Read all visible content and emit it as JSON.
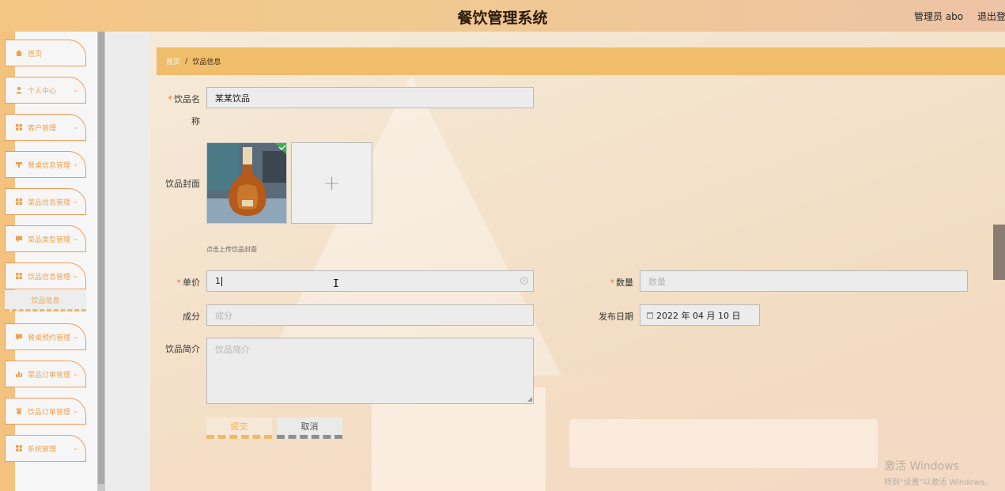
{
  "header": {
    "title": "餐饮管理系统",
    "user_label": "管理员 abo",
    "logout_label": "退出登"
  },
  "sidebar": {
    "items": [
      {
        "label": "首页",
        "icon": "home-icon",
        "has_chevron": false
      },
      {
        "label": "个人中心",
        "icon": "user-icon",
        "has_chevron": true
      },
      {
        "label": "客户管理",
        "icon": "grid-icon",
        "has_chevron": true
      },
      {
        "label": "餐桌信息管理",
        "icon": "table-icon",
        "has_chevron": true
      },
      {
        "label": "菜品信息管理",
        "icon": "grid-icon",
        "has_chevron": true
      },
      {
        "label": "菜品类型管理",
        "icon": "chat-icon",
        "has_chevron": true
      },
      {
        "label": "饮品信息管理",
        "icon": "grid-icon",
        "has_chevron": true
      },
      {
        "label": "餐桌预约管理",
        "icon": "chat-icon",
        "has_chevron": true
      },
      {
        "label": "菜品订单管理",
        "icon": "bar-chart-icon",
        "has_chevron": true
      },
      {
        "label": "饮品订单管理",
        "icon": "trash-icon",
        "has_chevron": true
      },
      {
        "label": "系统管理",
        "icon": "grid-icon",
        "has_chevron": true
      }
    ],
    "active_submenu": "饮品信息"
  },
  "breadcrumb": {
    "home": "首页",
    "separator": "/",
    "current": "饮品信息"
  },
  "form": {
    "name_label_line1": "饮品名",
    "name_label_line2": "称",
    "name_value": "某某饮品",
    "cover_label": "饮品封面",
    "cover_hint": "点击上传饮品封面",
    "add_symbol": "+",
    "price_label": "单价",
    "price_value": "1",
    "quantity_label": "数量",
    "quantity_placeholder": "数量",
    "ingredient_label": "成分",
    "ingredient_placeholder": "成分",
    "date_label": "发布日期",
    "date_value": "2022 年 04 月 10 日",
    "intro_label": "饮品简介",
    "intro_placeholder": "饮品简介",
    "required_mark": "*",
    "submit_label": "提交",
    "cancel_label": "取消"
  },
  "watermark": {
    "line1": "激活 Windows",
    "line2": "转到\"设置\"以激活 Windows。"
  },
  "colors": {
    "accent": "#f0bd6a",
    "menu_text": "#f0a24c",
    "menu_border": "#ee9a56",
    "required": "#f06c3a"
  }
}
